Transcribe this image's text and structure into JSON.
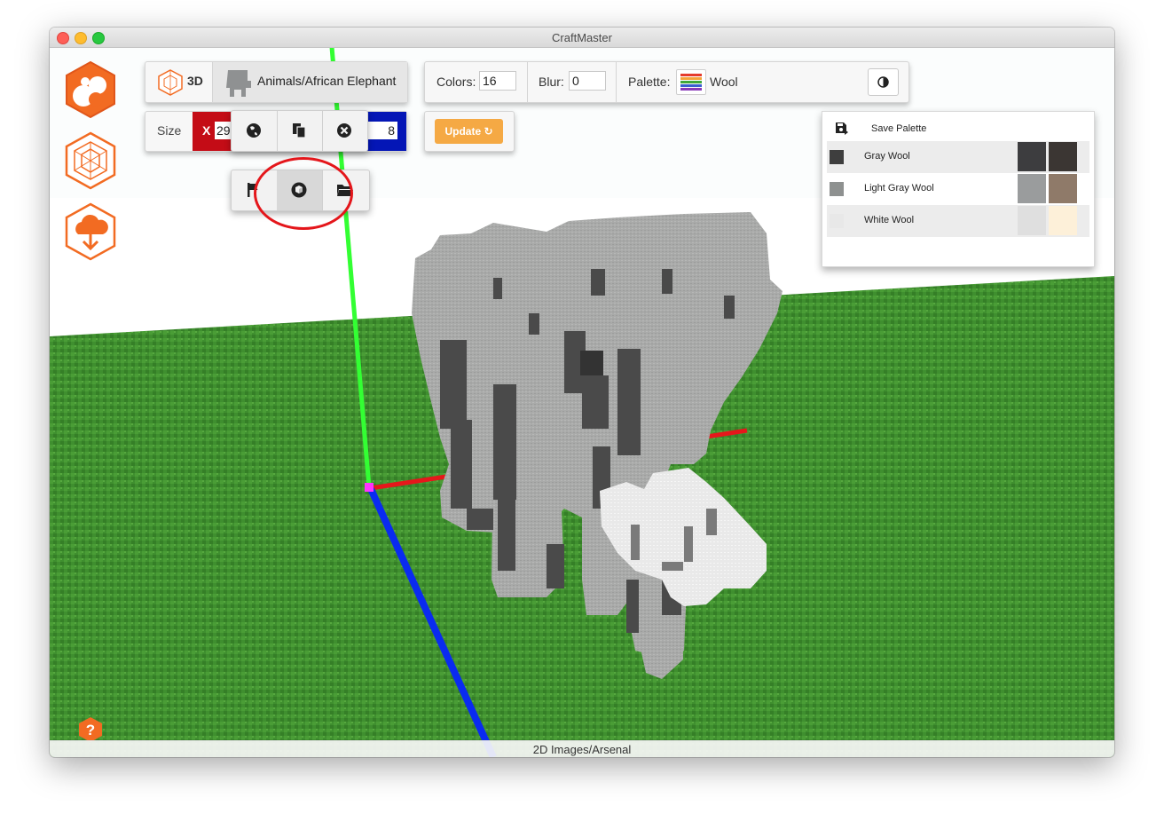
{
  "window": {
    "title": "CraftMaster"
  },
  "toolbar": {
    "mode_label": "3D",
    "model_name": "Animals/African Elephant",
    "size_label": "Size",
    "size_x_letter": "X",
    "size_x_value": "29",
    "size_z_value": "8",
    "colors_label": "Colors:",
    "colors_value": "16",
    "blur_label": "Blur:",
    "blur_value": "0",
    "palette_label": "Palette:",
    "palette_value": "Wool",
    "update_label": "Update"
  },
  "popup_top": {
    "buttons": [
      "globe-icon",
      "copy-icon",
      "close-icon"
    ]
  },
  "popup_bottom": {
    "buttons": [
      "flag-icon",
      "cube-icon",
      "folder-open-icon"
    ],
    "active": "cube-icon"
  },
  "palette_dropdown": {
    "save_label": "Save Palette",
    "items": [
      {
        "name": "Gray Wool",
        "swatch": "#3e3e3e",
        "c1": "#3d3d3f",
        "c2": "#3b3633"
      },
      {
        "name": "Light Gray Wool",
        "swatch": "#8e9190",
        "c1": "#9a9c9d",
        "c2": "#8f7a69"
      },
      {
        "name": "White Wool",
        "swatch": "#e8e8e8",
        "c1": "#dfdfdf",
        "c2": "#fdf0d9"
      }
    ]
  },
  "sidebar": {
    "items": [
      "pixel-art-icon",
      "3d-model-icon",
      "import-icon"
    ]
  },
  "status_bar": {
    "text": "2D Images/Arsenal"
  },
  "colors": {
    "accent": "#f26b22",
    "ground": "#3f8f2f",
    "update": "#f5a944",
    "axis_x": "#e6171b",
    "axis_y": "#33ff33",
    "axis_z": "#0a2bf0"
  }
}
